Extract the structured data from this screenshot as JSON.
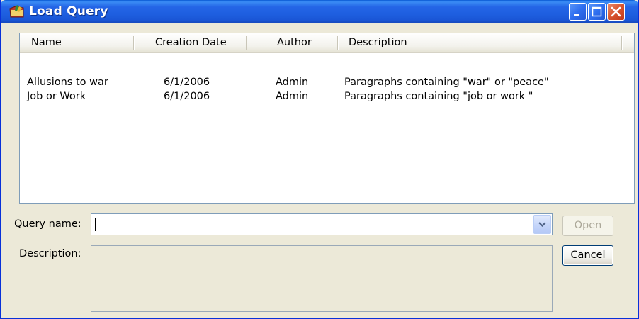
{
  "window": {
    "title": "Load Query"
  },
  "list": {
    "columns": [
      "Name",
      "Creation Date",
      "Author",
      "Description"
    ],
    "rows": [
      {
        "name": "Allusions to war",
        "date": "6/1/2006",
        "author": "Admin",
        "description": "Paragraphs containing \"war\" or \"peace\""
      },
      {
        "name": "Job or Work",
        "date": "6/1/2006",
        "author": "Admin",
        "description": "Paragraphs containing \"job or work \""
      }
    ]
  },
  "form": {
    "query_name_label": "Query name:",
    "query_name_value": "",
    "description_label": "Description:",
    "description_value": ""
  },
  "buttons": {
    "open": "Open",
    "cancel": "Cancel"
  },
  "icons": {
    "app": "query-folder-icon",
    "minimize": "minimize-icon",
    "maximize": "maximize-icon",
    "close": "close-icon",
    "dropdown": "chevron-down-icon"
  }
}
